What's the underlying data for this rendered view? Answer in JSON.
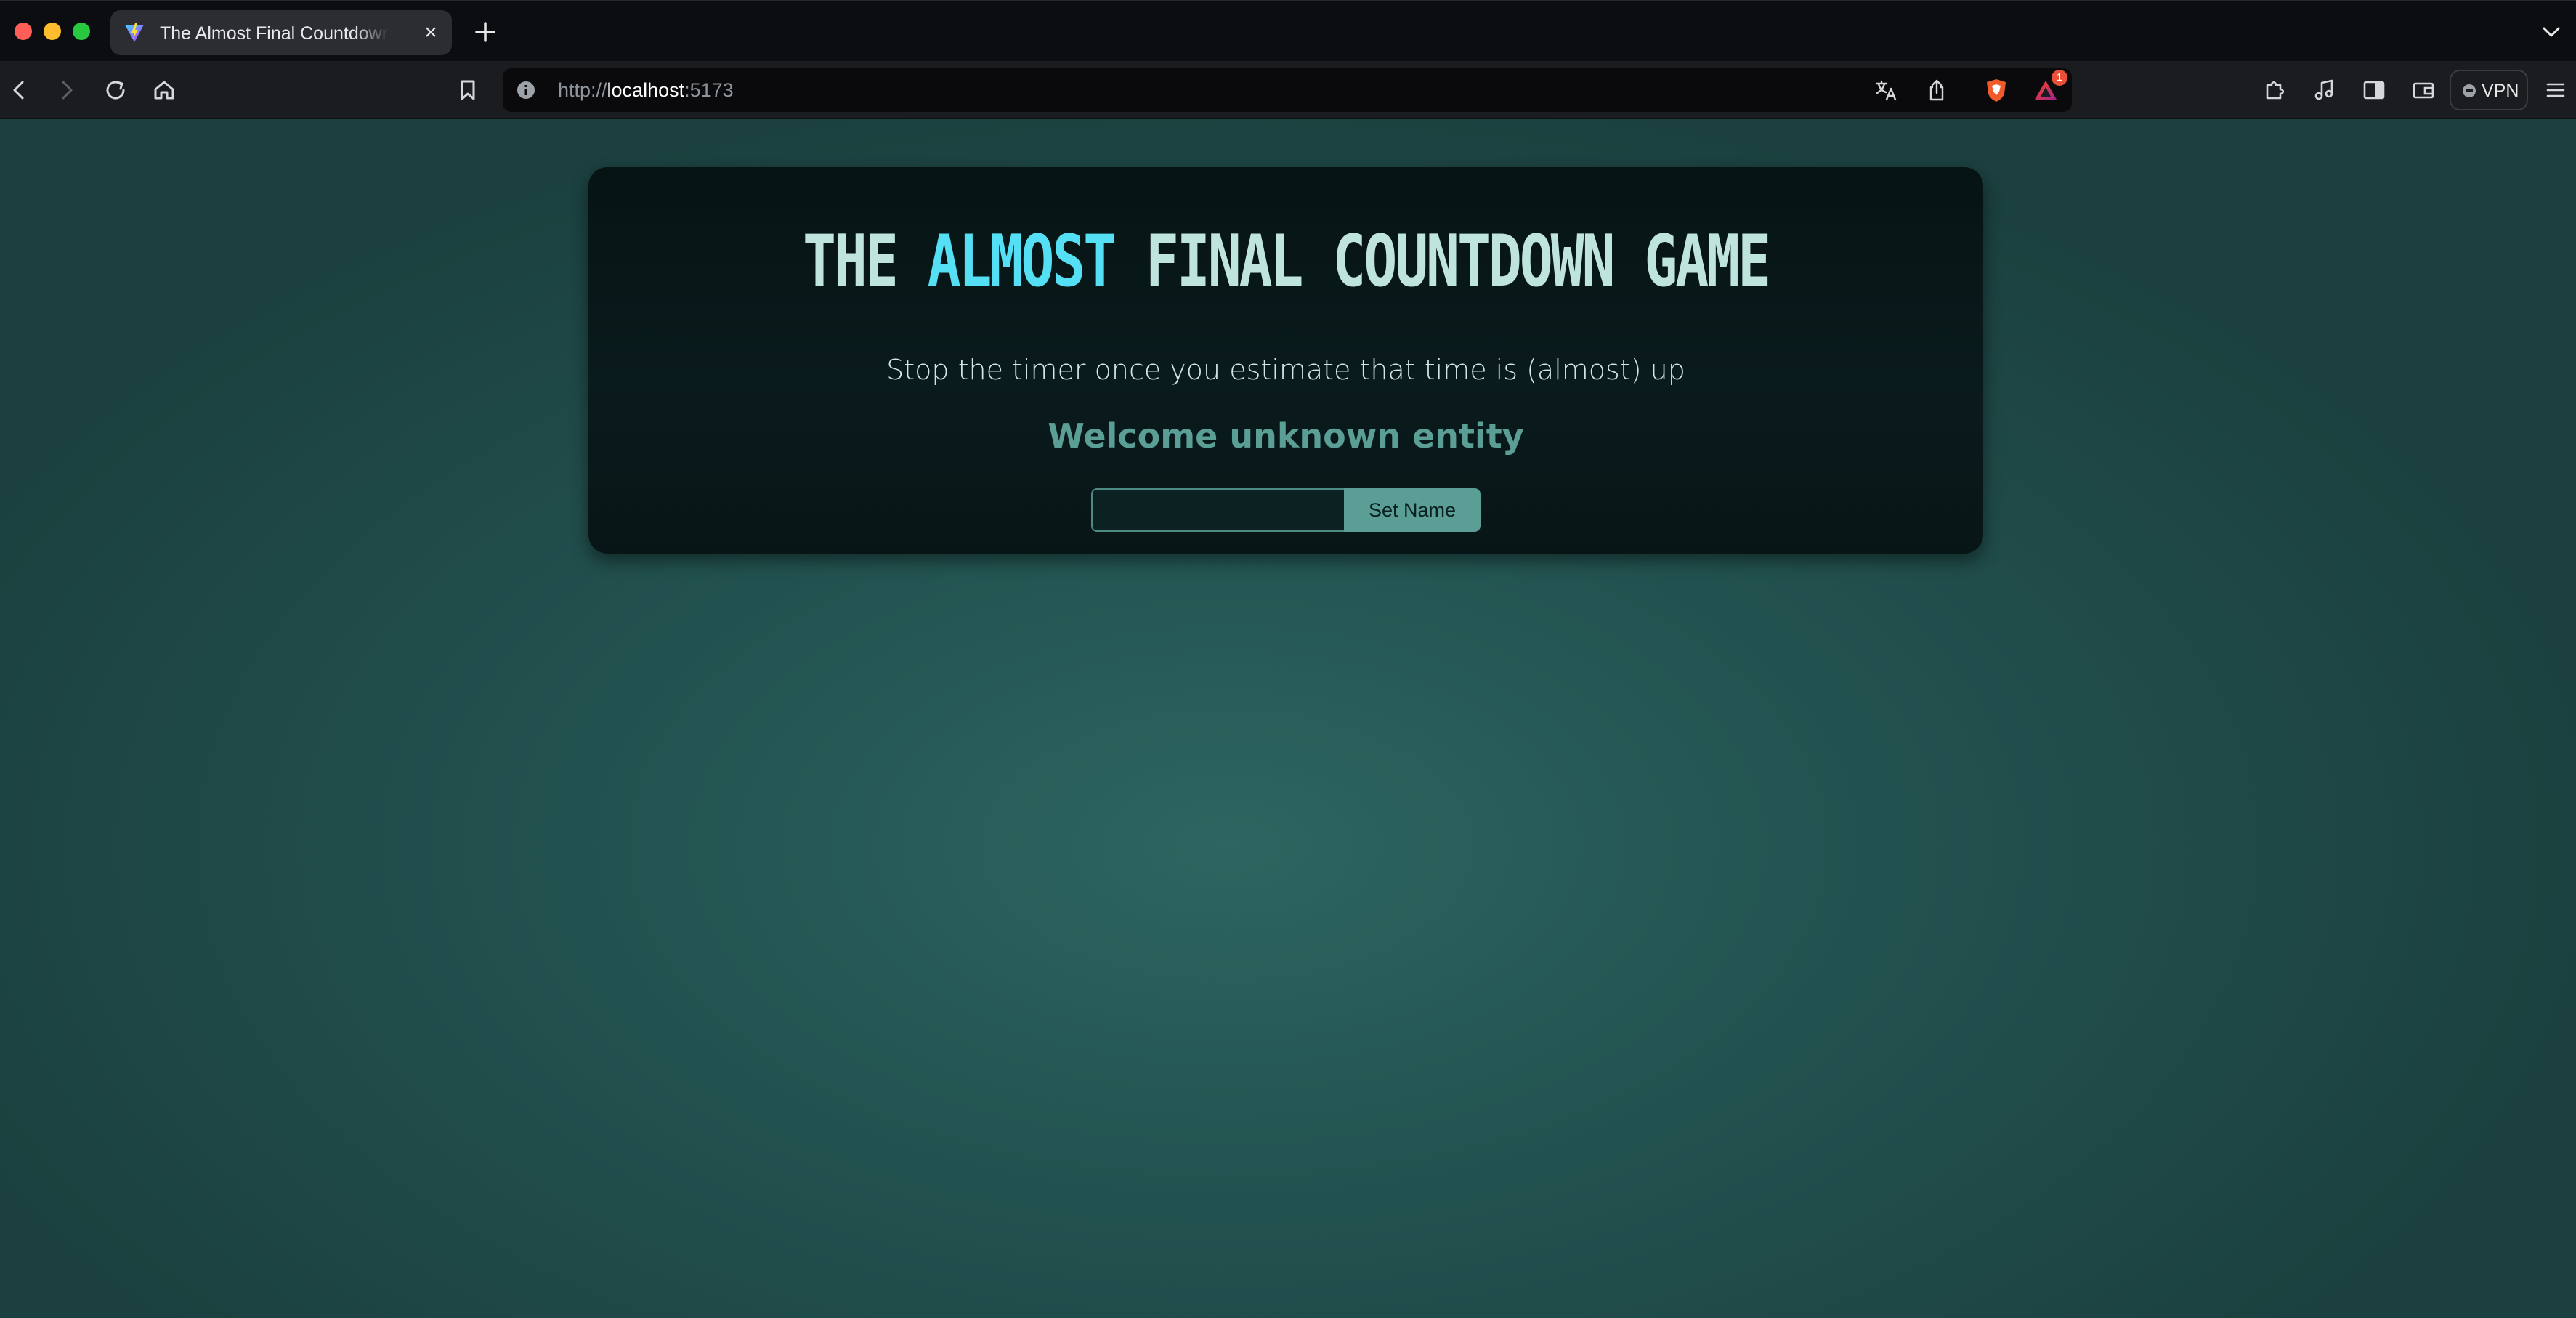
{
  "browser": {
    "tab": {
      "title": "The Almost Final Countdown Game",
      "close_glyph": "×"
    },
    "url": {
      "scheme": "http://",
      "host": "localhost",
      "port": ":5173"
    },
    "notification_count": "1",
    "vpn_label": "VPN",
    "icons": [
      "vite-favicon-icon",
      "new-tab-icon",
      "tabs-menu-icon",
      "back-icon",
      "forward-icon",
      "reload-icon",
      "home-icon",
      "bookmark-icon",
      "site-info-icon",
      "translate-icon",
      "share-icon",
      "brave-shields-icon",
      "brave-rewards-icon",
      "extensions-icon",
      "media-icon",
      "sidebar-icon",
      "wallet-icon",
      "menu-icon"
    ]
  },
  "page": {
    "title_part1": "THE ",
    "title_highlight": "ALMOST",
    "title_part2": " FINAL COUNTDOWN GAME",
    "subtitle": "Stop the timer once you estimate that time is (almost) up",
    "welcome": "Welcome unknown entity",
    "name_input_value": "",
    "name_input_placeholder": "",
    "set_name_label": "Set Name"
  },
  "colors": {
    "accent": "#55dff5",
    "title": "#bfe4de",
    "button": "#5b9e96",
    "welcome": "#5b9e96",
    "background": "#235451"
  }
}
